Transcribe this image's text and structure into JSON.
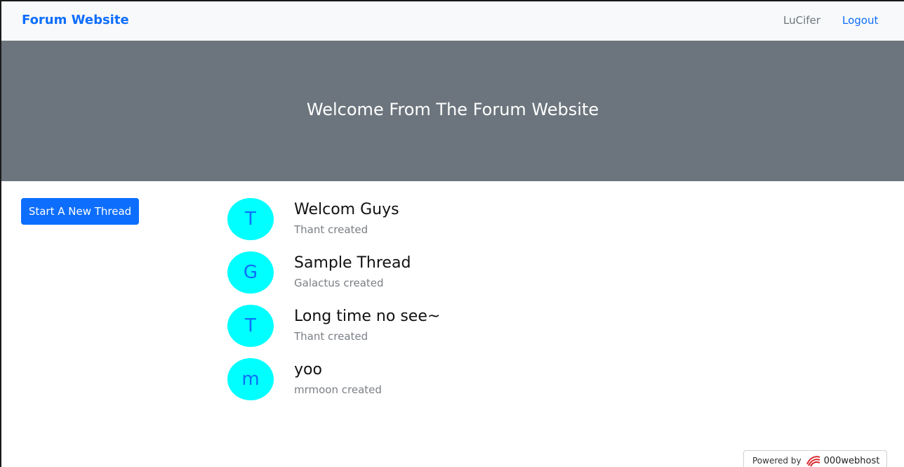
{
  "navbar": {
    "brand": "Forum Website",
    "user": "LuCifer",
    "logout": "Logout"
  },
  "hero": {
    "title": "Welcome From The Forum Website"
  },
  "sidebar": {
    "new_thread_label": "Start A New Thread"
  },
  "threads": [
    {
      "initial": "T",
      "title": "Welcom Guys",
      "meta": "Thant created"
    },
    {
      "initial": "G",
      "title": "Sample Thread",
      "meta": "Galactus created"
    },
    {
      "initial": "T",
      "title": "Long time no see~",
      "meta": "Thant created"
    },
    {
      "initial": "m",
      "title": "yoo",
      "meta": "mrmoon created"
    }
  ],
  "footer": {
    "powered_by": "Powered by",
    "host": "000webhost"
  },
  "colors": {
    "primary": "#0d6efd",
    "hero_bg": "#6c757d",
    "avatar_bg": "#00ffff",
    "navbar_bg": "#f8f9fa"
  }
}
